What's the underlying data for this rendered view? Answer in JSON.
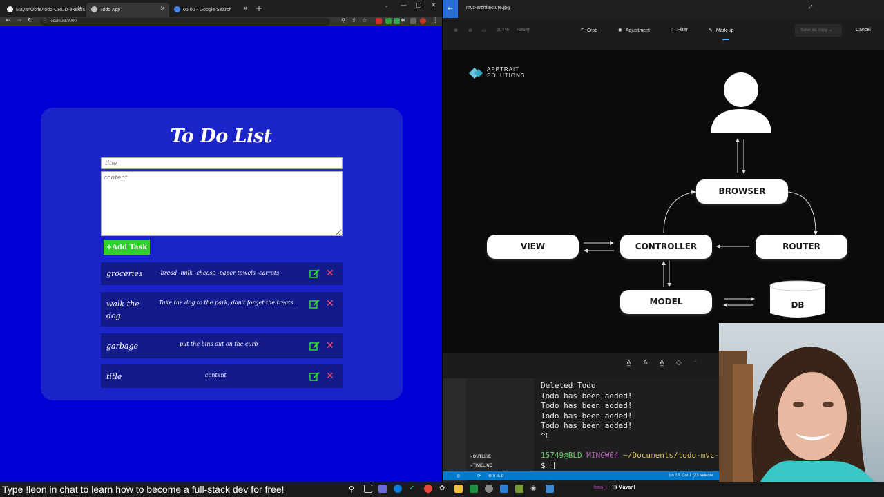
{
  "browser": {
    "tabs": [
      {
        "label": "Mayanwolfe/todo-CRUD-exercis"
      },
      {
        "label": "Todo App"
      },
      {
        "label": "05:00 - Google Search"
      }
    ],
    "url": "localhost:8000"
  },
  "todo_app": {
    "heading": "To Do List",
    "title_placeholder": "title",
    "content_placeholder": "content",
    "add_button": "+Add Task",
    "items": [
      {
        "title": "groceries",
        "content": "-bread -milk -cheese -paper towels -carrots"
      },
      {
        "title": "walk the dog",
        "content": "Take the dog to the park, don't forget the treats."
      },
      {
        "title": "garbage",
        "content": "put the bins out on the curb"
      },
      {
        "title": "title",
        "content": "content"
      }
    ]
  },
  "photos": {
    "filename": "mvc-architecture.jpg",
    "zoom": "107%",
    "reset": "Reset",
    "tools": [
      "Crop",
      "Adjustment",
      "Filter",
      "Mark-up"
    ],
    "save_as": "Save as copy",
    "cancel": "Cancel",
    "diagram": {
      "brand_line1": "APPTRAIT",
      "brand_line2": "SOLUTIONS",
      "nodes": {
        "browser": "BROWSER",
        "view": "VIEW",
        "controller": "CONTROLLER",
        "router": "ROUTER",
        "model": "MODEL",
        "db": "DB"
      }
    }
  },
  "terminal": {
    "lines": [
      "Deleted Todo",
      "Todo has been added!",
      "Todo has been added!",
      "Todo has been added!",
      "Todo has been added!",
      "^C"
    ],
    "prompt_user": "15749@BLD",
    "prompt_env": "MINGW64",
    "prompt_path": "~/Documents/todo-mvc-e",
    "prompt_symbol": "$",
    "outline": "OUTLINE",
    "timeline": "TIMELINE",
    "status_left": "⊗ 0 ⚠ 0",
    "status_right": "Ln 15, Col 1 (23 selecte"
  },
  "stream": {
    "ticker": "Type !leon in chat to learn how to become a full-stack dev for free!",
    "chat_user": "fosa_j",
    "chat_message": "Hi Mayan!"
  }
}
